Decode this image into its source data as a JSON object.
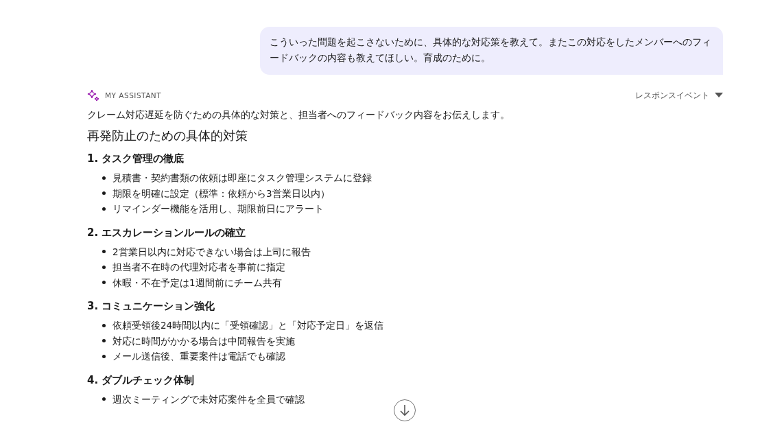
{
  "user_message": {
    "text": "こういった問題を起こさないために、具体的な対応策を教えて。またこの対応をしたメンバーへのフィードバックの内容も教えてほしい。育成のために。"
  },
  "assistant": {
    "label": "MY ASSISTANT",
    "response_menu": "レスポンスイベント",
    "intro": "クレーム対応遅延を防ぐための具体的な対策と、担当者へのフィードバック内容をお伝えします。",
    "heading": "再発防止のための具体的対策",
    "sections": [
      {
        "title": "1. タスク管理の徹底",
        "items": [
          "見積書・契約書類の依頼は即座にタスク管理システムに登録",
          "期限を明確に設定（標準：依頼から3営業日以内）",
          "リマインダー機能を活用し、期限前日にアラート"
        ]
      },
      {
        "title": "2. エスカレーションルールの確立",
        "items": [
          "2営業日以内に対応できない場合は上司に報告",
          "担当者不在時の代理対応者を事前に指定",
          "休暇・不在予定は1週間前にチーム共有"
        ]
      },
      {
        "title": "3. コミュニケーション強化",
        "items": [
          "依頼受領後24時間以内に「受領確認」と「対応予定日」を返信",
          "対応に時間がかかる場合は中間報告を実施",
          "メール送信後、重要案件は電話でも確認"
        ]
      },
      {
        "title": "4. ダブルチェック体制",
        "items": [
          "週次ミーティングで未対応案件を全員で確認"
        ]
      }
    ]
  }
}
